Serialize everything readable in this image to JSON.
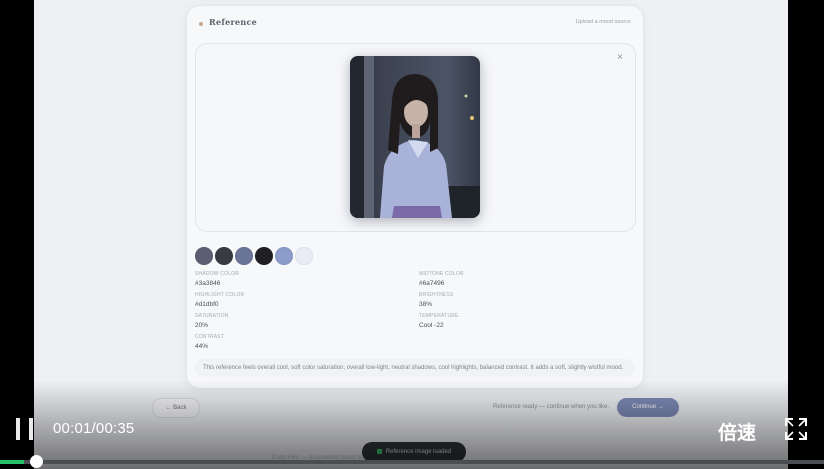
{
  "card": {
    "title": "Reference",
    "upload_link": "Upload a mood source",
    "close_label": "×"
  },
  "palette": {
    "swatches": [
      {
        "color": "#5b5e73"
      },
      {
        "color": "#3a3b40"
      },
      {
        "color": "#6a7496"
      },
      {
        "color": "#1f1e22"
      },
      {
        "color": "#8a9bcc"
      },
      {
        "color": "#e9ebf4"
      }
    ]
  },
  "stats": {
    "shadow_color": {
      "label": "SHADOW COLOR",
      "value": "#3a3846"
    },
    "midtone_color": {
      "label": "MIDTONE COLOR",
      "value": "#6a7496"
    },
    "highlight_color": {
      "label": "HIGHLIGHT COLOR",
      "value": "#d1dbf0"
    },
    "brightness": {
      "label": "BRIGHTNESS",
      "value": "38%"
    },
    "saturation": {
      "label": "SATURATION",
      "value": "20%"
    },
    "temperature": {
      "label": "TEMPERATURE",
      "value": "Cool -22"
    },
    "contrast": {
      "label": "CONTRAST",
      "value": "44%"
    }
  },
  "note": "This reference feels overall cool, soft color saturation, overall low-light, neutral shadows, cool highlights, balanced contrast. It adds a soft, slightly wistful mood.",
  "nav": {
    "back_label": "← Back",
    "ready_text": "Reference ready — continue when you like.",
    "continue_label": "Continue →"
  },
  "footer": {
    "text": "Color Film — AI-powered mood grading and palette extraction"
  },
  "toast": {
    "text": "Reference image loaded"
  },
  "player": {
    "time": "00:01/00:35",
    "speed_label": "倍速",
    "progress_fraction": 0.029
  },
  "colors": {
    "accent": "#7d8bb8",
    "progress": "#25c067"
  }
}
